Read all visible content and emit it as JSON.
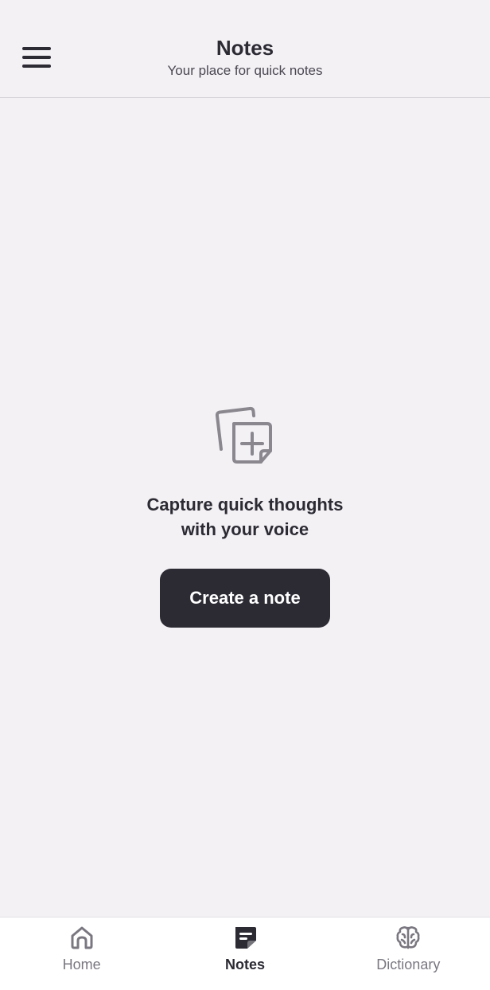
{
  "header": {
    "title": "Notes",
    "subtitle": "Your place for quick notes"
  },
  "empty_state": {
    "line1": "Capture quick thoughts",
    "line2": "with your voice",
    "button_label": "Create a note"
  },
  "bottom_nav": {
    "items": [
      {
        "label": "Home",
        "icon": "home-icon",
        "active": false
      },
      {
        "label": "Notes",
        "icon": "notes-icon",
        "active": true
      },
      {
        "label": "Dictionary",
        "icon": "brain-icon",
        "active": false
      }
    ]
  },
  "colors": {
    "background": "#f3f1f4",
    "primary": "#2c2a33",
    "inactive": "#7a7780",
    "nav_background": "#ffffff"
  }
}
